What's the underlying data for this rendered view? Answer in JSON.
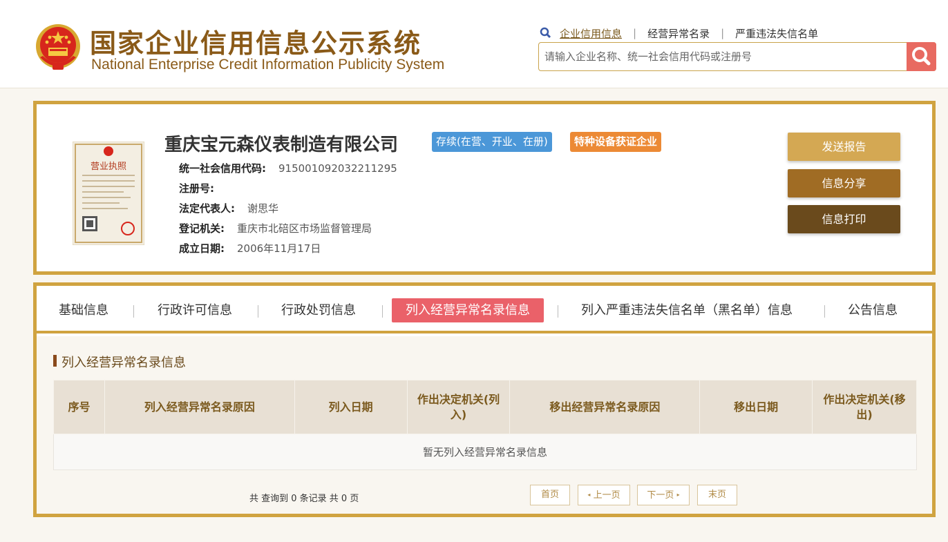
{
  "header": {
    "title_zh": "国家企业信用信息公示系统",
    "title_en": "National Enterprise Credit Information Publicity System",
    "links": [
      "企业信用信息",
      "经营异常名录",
      "严重违法失信名单"
    ],
    "search_placeholder": "请输入企业名称、统一社会信用代码或注册号"
  },
  "company": {
    "name": "重庆宝元森仪表制造有限公司",
    "status_badge": "存续(在营、开业、在册)",
    "special_badge": "特种设备获证企业",
    "fields": [
      {
        "label": "统一社会信用代码:",
        "value": "915001092032211295"
      },
      {
        "label": "注册号:",
        "value": ""
      },
      {
        "label": "法定代表人:",
        "value": "谢思华"
      },
      {
        "label": "登记机关:",
        "value": "重庆市北碚区市场监督管理局"
      },
      {
        "label": "成立日期:",
        "value": "2006年11月17日"
      }
    ],
    "license_title": "营业执照",
    "actions": [
      "发送报告",
      "信息分享",
      "信息打印"
    ]
  },
  "tabs": [
    "基础信息",
    "行政许可信息",
    "行政处罚信息",
    "列入经营异常名录信息",
    "列入严重违法失信名单（黑名单）信息",
    "公告信息"
  ],
  "active_tab": "列入经营异常名录信息",
  "section": {
    "title": "列入经营异常名录信息",
    "columns": [
      "序号",
      "列入经营异常名录原因",
      "列入日期",
      "作出决定机关(列入)",
      "移出经营异常名录原因",
      "移出日期",
      "作出决定机关(移出)"
    ],
    "empty_text": "暂无列入经营异常名录信息"
  },
  "pager": {
    "info": "共 查询到 0 条记录 共 0 页",
    "first": "首页",
    "prev": "上一页",
    "next": "下一页",
    "last": "末页"
  },
  "icons": [
    "national-emblem-icon",
    "magnifier-icon",
    "search-icon",
    "license-image",
    "triangle-left-icon",
    "triangle-right-icon"
  ],
  "colors": {
    "brand_gold": "#d0a340",
    "brand_brown": "#8a5a18",
    "active_tab": "#ea6169",
    "status_blue": "#4b97d8",
    "special_orange": "#ec8a35",
    "search_red": "#e86a61"
  }
}
